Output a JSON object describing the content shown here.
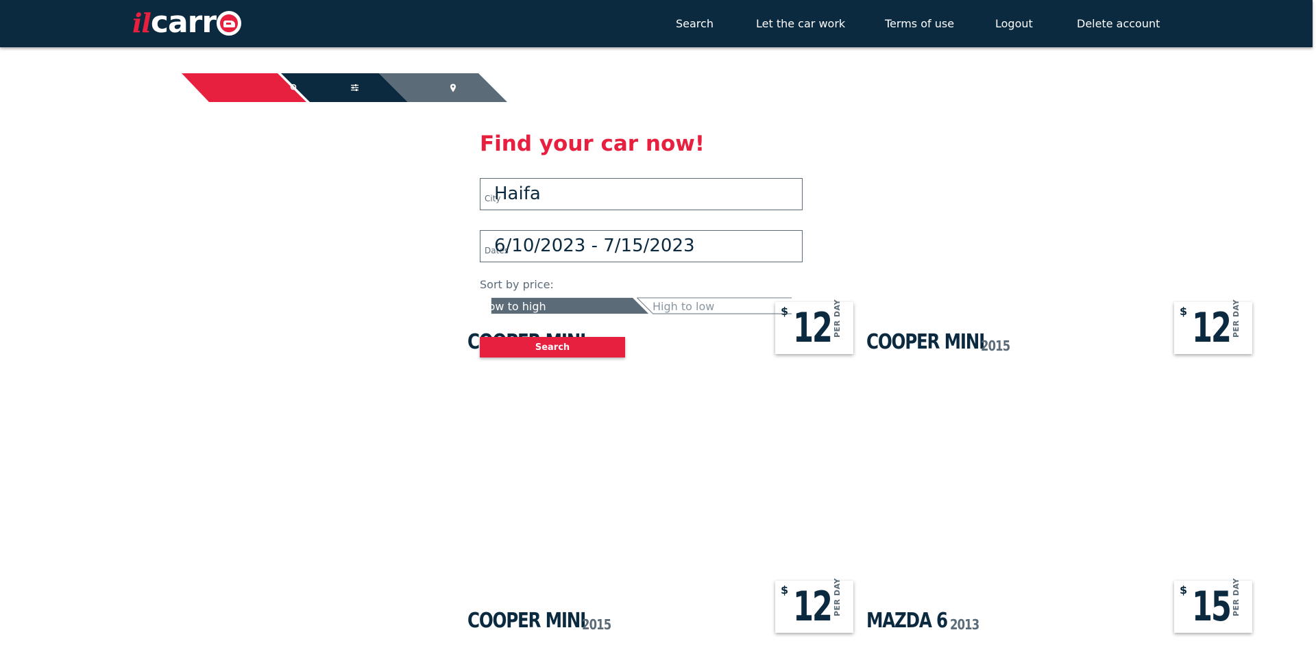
{
  "header": {
    "logo": {
      "part1": "il",
      "part2": "carr"
    },
    "nav": [
      {
        "label": "Search"
      },
      {
        "label": "Let the car work"
      },
      {
        "label": "Terms of use"
      },
      {
        "label": "Logout"
      },
      {
        "label": "Delete account"
      }
    ]
  },
  "tabs": {
    "icons": [
      "search-icon",
      "sliders-icon",
      "map-pin-icon"
    ],
    "colors": [
      "#e8203f",
      "#0b2a3f",
      "#5b6b78"
    ]
  },
  "search_form": {
    "title": "Find your car now!",
    "city": {
      "label": "City",
      "value": "Haifa"
    },
    "dates": {
      "label": "Dates",
      "value": "6/10/2023 - 7/15/2023"
    },
    "sort_label": "Sort by price:",
    "sort_options": [
      {
        "label": "Low to high",
        "selected": true
      },
      {
        "label": "High to low",
        "selected": false
      }
    ],
    "search_button": "Search"
  },
  "cars": [
    {
      "name": "COOPER MINI",
      "year": "",
      "currency": "$",
      "price": "12",
      "per": "PER DAY"
    },
    {
      "name": "COOPER MINI",
      "year": "2015",
      "currency": "$",
      "price": "12",
      "per": "PER DAY"
    },
    {
      "name": "COOPER MINI",
      "year": "2015",
      "currency": "$",
      "price": "12",
      "per": "PER DAY"
    },
    {
      "name": "MAZDA 6",
      "year": "2013",
      "currency": "$",
      "price": "15",
      "per": "PER DAY"
    }
  ],
  "colors": {
    "header_bg": "#0b2a3f",
    "accent": "#e8203f",
    "secondary": "#5b6b78"
  }
}
